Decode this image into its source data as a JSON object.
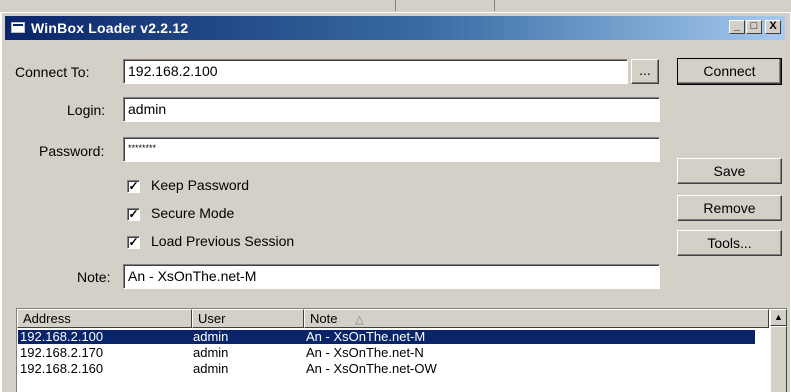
{
  "window": {
    "title": "WinBox Loader v2.2.12",
    "controls": {
      "minimize": "_",
      "maximize": "□",
      "close": "X"
    }
  },
  "form": {
    "connect_to_label": "Connect To:",
    "connect_to_value": "192.168.2.100",
    "browse_label": "...",
    "login_label": "Login:",
    "login_value": "admin",
    "password_label": "Password:",
    "password_value": "********",
    "keep_password_label": "Keep Password",
    "keep_password_checked": true,
    "secure_mode_label": "Secure Mode",
    "secure_mode_checked": true,
    "load_previous_label": "Load Previous Session",
    "load_previous_checked": true,
    "note_label": "Note:",
    "note_value": "An - XsOnThe.net-M",
    "check_glyph": "✓"
  },
  "buttons": {
    "connect": "Connect",
    "save": "Save",
    "remove": "Remove",
    "tools": "Tools..."
  },
  "list": {
    "columns": [
      "Address",
      "User",
      "Note"
    ],
    "sort_indicator": "△",
    "rows": [
      {
        "address": "192.168.2.100",
        "user": "admin",
        "note": "An - XsOnThe.net-M",
        "selected": true
      },
      {
        "address": "192.168.2.170",
        "user": "admin",
        "note": "An - XsOnThe.net-N",
        "selected": false
      },
      {
        "address": "192.168.2.160",
        "user": "admin",
        "note": "An - XsOnThe.net-OW",
        "selected": false
      }
    ],
    "scroll_up_glyph": "▲"
  },
  "colors": {
    "title_gradient_start": "#0a246a",
    "selection": "#0a246a",
    "face": "#d4d0c8"
  }
}
